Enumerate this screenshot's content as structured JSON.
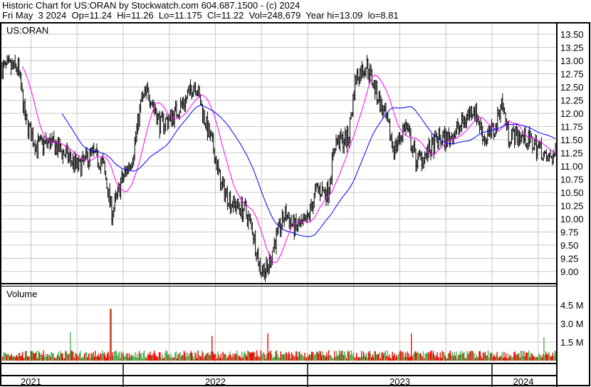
{
  "header": {
    "line1": "Historic Chart for US:ORAN by Stockwatch.com 604.687.1500 - (c) 2024",
    "line2": "Fri May  3 2024  Op=11.24  Hi=11.26  Lo=11.175  Cl=11.22  Vol=248,679  Year hi=13.09  lo=8.81"
  },
  "colors": {
    "up": "#4caf50",
    "down": "#ff0000",
    "ma_short": "#ff00ff",
    "ma_long": "#0000ff",
    "grid": "#c8c8c8"
  },
  "chart_data": {
    "type": "line",
    "title": "US:ORAN",
    "volume_title": "Volume",
    "price_ylim": [
      8.8,
      13.6
    ],
    "price_ticks": [
      "13.50",
      "13.25",
      "13.00",
      "12.75",
      "12.50",
      "12.25",
      "12.00",
      "11.75",
      "11.50",
      "11.25",
      "11.00",
      "10.75",
      "10.50",
      "10.25",
      "10.00",
      "9.75",
      "9.50",
      "9.25",
      "9.00"
    ],
    "volume_ticks": [
      {
        "label": "4.5 M",
        "value": 4.5
      },
      {
        "label": "3.0 M",
        "value": 3.0
      },
      {
        "label": "1.5 M",
        "value": 1.5
      }
    ],
    "x_labels": [
      {
        "label": "2021",
        "x": 2021.5
      },
      {
        "label": "2022",
        "x": 2022.5
      },
      {
        "label": "2023",
        "x": 2023.5
      },
      {
        "label": "2024",
        "x": 2024.17
      }
    ],
    "xlim": [
      2021.34,
      2024.35
    ],
    "series": [
      {
        "name": "Close",
        "x": [
          2021.35,
          2021.43,
          2021.47,
          2021.53,
          2021.6,
          2021.68,
          2021.76,
          2021.83,
          2021.89,
          2021.94,
          2021.99,
          2022.05,
          2022.1,
          2022.14,
          2022.2,
          2022.26,
          2022.34,
          2022.39,
          2022.45,
          2022.49,
          2022.53,
          2022.59,
          2022.66,
          2022.7,
          2022.74,
          2022.78,
          2022.82,
          2022.88,
          2022.93,
          2022.99,
          2023.05,
          2023.11,
          2023.15,
          2023.22,
          2023.26,
          2023.32,
          2023.36,
          2023.42,
          2023.47,
          2023.53,
          2023.59,
          2023.65,
          2023.71,
          2023.76,
          2023.82,
          2023.9,
          2023.96,
          2024.02,
          2024.05,
          2024.09,
          2024.15,
          2024.21,
          2024.27,
          2024.29,
          2024.34
        ],
        "y": [
          12.86,
          12.86,
          11.85,
          11.38,
          11.45,
          11.24,
          10.97,
          11.24,
          11.04,
          10.1,
          10.7,
          11.17,
          12.26,
          12.4,
          11.78,
          11.92,
          12.26,
          12.6,
          11.78,
          11.31,
          10.64,
          10.3,
          10.16,
          9.82,
          9.08,
          9.01,
          9.55,
          10.1,
          9.82,
          9.89,
          10.57,
          10.5,
          11.45,
          11.51,
          12.66,
          12.93,
          12.53,
          11.92,
          11.31,
          11.78,
          11.1,
          11.24,
          11.51,
          11.51,
          11.72,
          12.12,
          11.51,
          11.72,
          12.26,
          11.58,
          11.58,
          11.45,
          11.31,
          11.1,
          11.22
        ]
      },
      {
        "name": "Volume (M)",
        "baseline": 0.6,
        "spikes": [
          {
            "x": 2021.93,
            "y": 4.2
          },
          {
            "x": 2021.71,
            "y": 2.3
          },
          {
            "x": 2022.48,
            "y": 2.0
          },
          {
            "x": 2022.78,
            "y": 2.2
          },
          {
            "x": 2023.56,
            "y": 2.2
          },
          {
            "x": 2024.28,
            "y": 1.9
          }
        ]
      }
    ]
  }
}
